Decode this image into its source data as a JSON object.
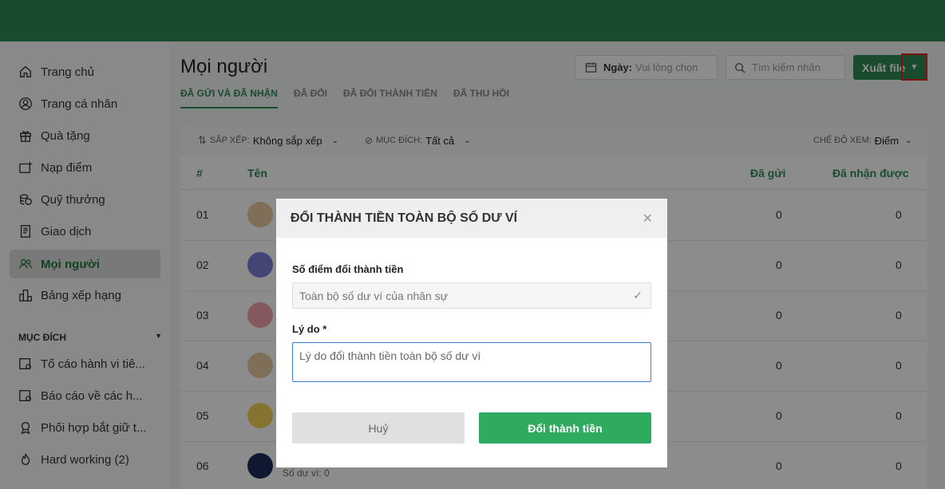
{
  "colors": {
    "brand": "#2e8b57",
    "primary_button": "#2eab5f"
  },
  "sidebar": {
    "items": [
      {
        "label": "Trang chủ",
        "icon": "home-icon"
      },
      {
        "label": "Trang cá nhân",
        "icon": "user-circle-icon"
      },
      {
        "label": "Quà tặng",
        "icon": "gift-icon"
      },
      {
        "label": "Nạp điểm",
        "icon": "top-up-icon"
      },
      {
        "label": "Quỹ thưởng",
        "icon": "coins-icon"
      },
      {
        "label": "Giao dịch",
        "icon": "receipt-icon"
      },
      {
        "label": "Mọi người",
        "icon": "users-icon"
      },
      {
        "label": "Bảng xếp hạng",
        "icon": "ranking-icon"
      }
    ],
    "section_title": "MỤC ĐÍCH",
    "purpose_items": [
      {
        "label": "Tố cáo hành vi tiê...",
        "icon": "report-icon"
      },
      {
        "label": "Báo cáo về các h...",
        "icon": "report-icon"
      },
      {
        "label": "Phối hợp bắt giữ t...",
        "icon": "badge-icon"
      },
      {
        "label": "Hard working (2)",
        "icon": "flame-icon"
      }
    ]
  },
  "main": {
    "title": "Mọi người",
    "tabs": [
      {
        "label": "ĐÃ GỬI VÀ ĐÃ NHẬN"
      },
      {
        "label": "ĐÃ ĐỔI"
      },
      {
        "label": "ĐÃ ĐỔI THÀNH TIỀN"
      },
      {
        "label": "ĐÃ THU HỒI"
      }
    ],
    "date_label": "Ngày:",
    "date_placeholder": "Vui lòng chọn",
    "search_placeholder": "Tìm kiếm nhân",
    "export_label": "Xuất file"
  },
  "toolbar": {
    "sort_label": "SẮP XẾP:",
    "sort_value": "Không sắp xếp",
    "purpose_label": "MỤC ĐÍCH:",
    "purpose_value": "Tất cả",
    "view_label": "CHẾ ĐỘ XEM:",
    "view_value": "Điểm"
  },
  "table": {
    "headers": {
      "num": "#",
      "name": "Tên",
      "sent": "Đã gửi",
      "received": "Đã nhận được"
    },
    "rows": [
      {
        "num": "01",
        "sent": "0",
        "received": "0"
      },
      {
        "num": "02",
        "sent": "0",
        "received": "0"
      },
      {
        "num": "03",
        "sent": "0",
        "received": "0"
      },
      {
        "num": "04",
        "sent": "0",
        "received": "0"
      },
      {
        "num": "05",
        "sent": "0",
        "received": "0"
      },
      {
        "num": "06",
        "sent": "0",
        "received": "0",
        "sub": "Số dư ví: 0"
      }
    ]
  },
  "modal": {
    "title": "ĐỔI THÀNH TIỀN TOÀN BỘ SỐ DƯ VÍ",
    "field1_label": "Số điểm đổi thành tiền",
    "field1_value": "Toàn bộ số dư ví của nhân sự",
    "field2_label": "Lý do *",
    "field2_placeholder": "Lý do đổi thành tiền toàn bộ số dư ví",
    "cancel_label": "Huỷ",
    "confirm_label": "Đổi thành tiền"
  }
}
